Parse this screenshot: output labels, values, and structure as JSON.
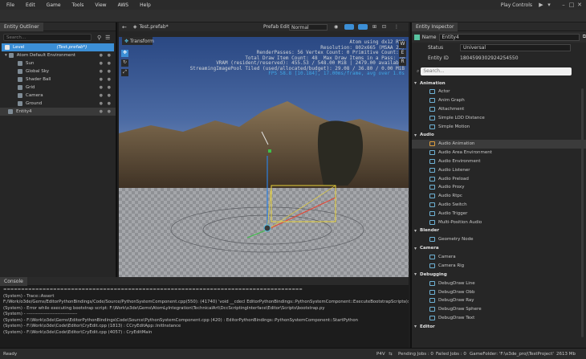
{
  "menu": {
    "items": [
      "File",
      "Edit",
      "Game",
      "Tools",
      "View",
      "AWS",
      "Help"
    ],
    "play_controls": "Play Controls"
  },
  "outliner": {
    "title": "Entity Outliner",
    "search_placeholder": "Search...",
    "level_label": "Level",
    "level_prefab": "(Test.prefab*)",
    "rows": [
      {
        "label": "Atom Default Environment"
      },
      {
        "label": "Sun"
      },
      {
        "label": "Global Sky"
      },
      {
        "label": "Shader Ball"
      },
      {
        "label": "Grid"
      },
      {
        "label": "Camera"
      },
      {
        "label": "Ground"
      },
      {
        "label": "Entity4"
      }
    ]
  },
  "viewport": {
    "tab_label": "Test.prefab*",
    "prefab_edit_label": "Prefab Edit:",
    "prefab_edit_value": "Normal",
    "transform_label": "Transform",
    "stats": [
      "Atom using dx12 RHI",
      "Resolution: 802x665 (MSAA 2x)",
      "RenderPasses: 56 Vertex Count: 0 Primitive Count: 0",
      "Total Draw Item Count: 48  Max Draw Items in a Pass: 20",
      "VRAM (resident/reserved): 455.53 / 548.00 MiB | 2479.00 available",
      "StreamingImagePool Tiled (used/allocated/budget): 29.08 / 36.80 / 0.00 MiB",
      "FPS 58.8 [10.184], 17.00ms/frame, avg over 1.0s"
    ],
    "side_buttons": [
      "W",
      "E",
      "R"
    ]
  },
  "inspector": {
    "title": "Entity Inspector",
    "name_label": "Name",
    "name_value": "Entity4",
    "status_label": "Status",
    "status_value": "Universal",
    "entity_id_label": "Entity ID",
    "entity_id_value": "1804599302924254550",
    "search_placeholder": "Search...",
    "categories": [
      {
        "name": "Animation",
        "items": [
          "Actor",
          "Anim Graph",
          "Attachment",
          "Simple LOD Distance",
          "Simple Motion"
        ]
      },
      {
        "name": "Audio",
        "items": [
          "Audio Animation",
          "Audio Area Environment",
          "Audio Environment",
          "Audio Listener",
          "Audio Preload",
          "Audio Proxy",
          "Audio Rtpc",
          "Audio Switch",
          "Audio Trigger",
          "Multi-Position Audio"
        ]
      },
      {
        "name": "Blender",
        "items": [
          "Geometry Node"
        ]
      },
      {
        "name": "Camera",
        "items": [
          "Camera",
          "Camera Rig"
        ]
      },
      {
        "name": "Debugging",
        "items": [
          "DebugDraw Line",
          "DebugDraw Obb",
          "DebugDraw Ray",
          "DebugDraw Sphere",
          "DebugDraw Text"
        ]
      },
      {
        "name": "Editor",
        "items": []
      }
    ],
    "selected_item": "Audio Animation"
  },
  "console": {
    "title": "Console",
    "lines": [
      "====================================================================================",
      "(System) - Trace::Assert",
      " F:/Work/o3de/Gems/EditorPythonBindings/Code/Source/PythonSystemComponent.cpp(550): (41740) 'void __cdecl EditorPythonBindings::PythonSystemComponent::ExecuteBootstrapScripts(const class",
      "(System) - Error while executing bootstrap script: F:\\Work\\o3de\\Gems\\AtomLyIntegration\\TechnicalArt\\DccScriptingInterface\\Editor\\Scripts\\bootstrap.py",
      "(System) - ---------------------------------",
      "(System) - F:\\Work\\o3de\\Gems\\EditorPythonBindings\\Code\\Source\\PythonSystemComponent.cpp (420) : EditorPythonBindings::PythonSystemComponent::StartPython",
      "(System) - F:\\Work\\o3de\\Code\\Editor\\CryEdit.cpp (1813) : CCryEditApp::InitInstance",
      "(System) - F:\\Work\\o3de\\Code\\Editor\\CryEdit.cpp (4057) : CryEditMain"
    ]
  },
  "status": {
    "ready": "Ready",
    "p4v": "P4V",
    "pending_jobs": "Pending Jobs : 0",
    "failed_jobs": "Failed Jobs : 0",
    "game_folder": "GameFolder: 'F:\\o3de_proj\\TestProject'",
    "memory": "2613 Mb"
  },
  "colors": {
    "accent": "#3c8fd6",
    "sky_top": "#2b4a8a",
    "sky_bottom": "#6a86b8",
    "stats_text": "#cfd3d8",
    "fps_text": "#3fa7e6"
  }
}
